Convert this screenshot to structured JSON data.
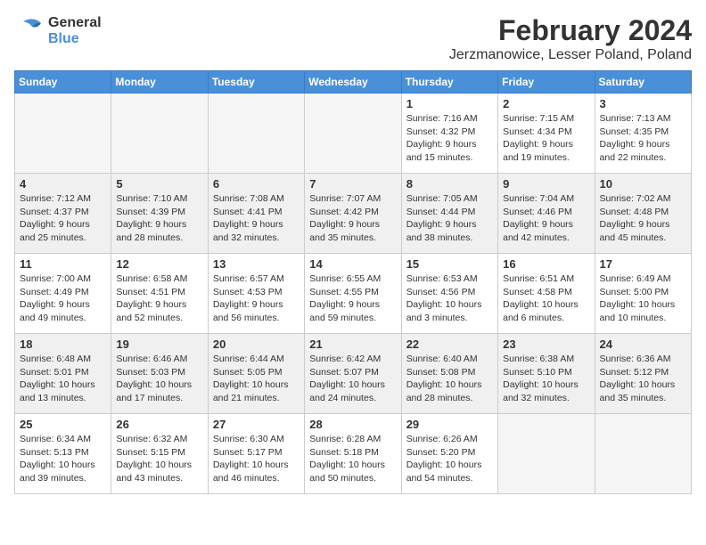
{
  "logo": {
    "general": "General",
    "blue": "Blue"
  },
  "title": "February 2024",
  "subtitle": "Jerzmanowice, Lesser Poland, Poland",
  "days_of_week": [
    "Sunday",
    "Monday",
    "Tuesday",
    "Wednesday",
    "Thursday",
    "Friday",
    "Saturday"
  ],
  "weeks": [
    [
      {
        "day": "",
        "detail": ""
      },
      {
        "day": "",
        "detail": ""
      },
      {
        "day": "",
        "detail": ""
      },
      {
        "day": "",
        "detail": ""
      },
      {
        "day": "1",
        "detail": "Sunrise: 7:16 AM\nSunset: 4:32 PM\nDaylight: 9 hours\nand 15 minutes."
      },
      {
        "day": "2",
        "detail": "Sunrise: 7:15 AM\nSunset: 4:34 PM\nDaylight: 9 hours\nand 19 minutes."
      },
      {
        "day": "3",
        "detail": "Sunrise: 7:13 AM\nSunset: 4:35 PM\nDaylight: 9 hours\nand 22 minutes."
      }
    ],
    [
      {
        "day": "4",
        "detail": "Sunrise: 7:12 AM\nSunset: 4:37 PM\nDaylight: 9 hours\nand 25 minutes."
      },
      {
        "day": "5",
        "detail": "Sunrise: 7:10 AM\nSunset: 4:39 PM\nDaylight: 9 hours\nand 28 minutes."
      },
      {
        "day": "6",
        "detail": "Sunrise: 7:08 AM\nSunset: 4:41 PM\nDaylight: 9 hours\nand 32 minutes."
      },
      {
        "day": "7",
        "detail": "Sunrise: 7:07 AM\nSunset: 4:42 PM\nDaylight: 9 hours\nand 35 minutes."
      },
      {
        "day": "8",
        "detail": "Sunrise: 7:05 AM\nSunset: 4:44 PM\nDaylight: 9 hours\nand 38 minutes."
      },
      {
        "day": "9",
        "detail": "Sunrise: 7:04 AM\nSunset: 4:46 PM\nDaylight: 9 hours\nand 42 minutes."
      },
      {
        "day": "10",
        "detail": "Sunrise: 7:02 AM\nSunset: 4:48 PM\nDaylight: 9 hours\nand 45 minutes."
      }
    ],
    [
      {
        "day": "11",
        "detail": "Sunrise: 7:00 AM\nSunset: 4:49 PM\nDaylight: 9 hours\nand 49 minutes."
      },
      {
        "day": "12",
        "detail": "Sunrise: 6:58 AM\nSunset: 4:51 PM\nDaylight: 9 hours\nand 52 minutes."
      },
      {
        "day": "13",
        "detail": "Sunrise: 6:57 AM\nSunset: 4:53 PM\nDaylight: 9 hours\nand 56 minutes."
      },
      {
        "day": "14",
        "detail": "Sunrise: 6:55 AM\nSunset: 4:55 PM\nDaylight: 9 hours\nand 59 minutes."
      },
      {
        "day": "15",
        "detail": "Sunrise: 6:53 AM\nSunset: 4:56 PM\nDaylight: 10 hours\nand 3 minutes."
      },
      {
        "day": "16",
        "detail": "Sunrise: 6:51 AM\nSunset: 4:58 PM\nDaylight: 10 hours\nand 6 minutes."
      },
      {
        "day": "17",
        "detail": "Sunrise: 6:49 AM\nSunset: 5:00 PM\nDaylight: 10 hours\nand 10 minutes."
      }
    ],
    [
      {
        "day": "18",
        "detail": "Sunrise: 6:48 AM\nSunset: 5:01 PM\nDaylight: 10 hours\nand 13 minutes."
      },
      {
        "day": "19",
        "detail": "Sunrise: 6:46 AM\nSunset: 5:03 PM\nDaylight: 10 hours\nand 17 minutes."
      },
      {
        "day": "20",
        "detail": "Sunrise: 6:44 AM\nSunset: 5:05 PM\nDaylight: 10 hours\nand 21 minutes."
      },
      {
        "day": "21",
        "detail": "Sunrise: 6:42 AM\nSunset: 5:07 PM\nDaylight: 10 hours\nand 24 minutes."
      },
      {
        "day": "22",
        "detail": "Sunrise: 6:40 AM\nSunset: 5:08 PM\nDaylight: 10 hours\nand 28 minutes."
      },
      {
        "day": "23",
        "detail": "Sunrise: 6:38 AM\nSunset: 5:10 PM\nDaylight: 10 hours\nand 32 minutes."
      },
      {
        "day": "24",
        "detail": "Sunrise: 6:36 AM\nSunset: 5:12 PM\nDaylight: 10 hours\nand 35 minutes."
      }
    ],
    [
      {
        "day": "25",
        "detail": "Sunrise: 6:34 AM\nSunset: 5:13 PM\nDaylight: 10 hours\nand 39 minutes."
      },
      {
        "day": "26",
        "detail": "Sunrise: 6:32 AM\nSunset: 5:15 PM\nDaylight: 10 hours\nand 43 minutes."
      },
      {
        "day": "27",
        "detail": "Sunrise: 6:30 AM\nSunset: 5:17 PM\nDaylight: 10 hours\nand 46 minutes."
      },
      {
        "day": "28",
        "detail": "Sunrise: 6:28 AM\nSunset: 5:18 PM\nDaylight: 10 hours\nand 50 minutes."
      },
      {
        "day": "29",
        "detail": "Sunrise: 6:26 AM\nSunset: 5:20 PM\nDaylight: 10 hours\nand 54 minutes."
      },
      {
        "day": "",
        "detail": ""
      },
      {
        "day": "",
        "detail": ""
      }
    ]
  ]
}
